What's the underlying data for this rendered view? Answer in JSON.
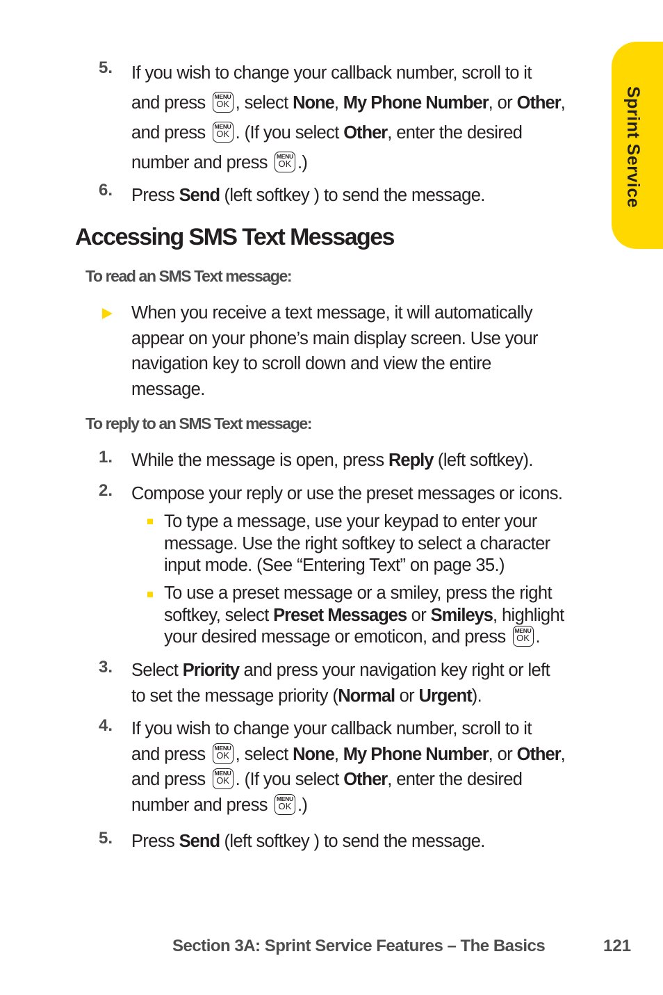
{
  "side_tab": {
    "label": "Sprint Service",
    "color": "#ffd800"
  },
  "key_icon": {
    "top": "MENU",
    "bottom": "OK"
  },
  "top_steps": [
    {
      "number": "5.",
      "lines": [
        [
          "If you wish to change your callback number, scroll to it"
        ],
        [
          "and press",
          "KEY",
          ", select ",
          "b:None",
          ", ",
          "b:My Phone Number",
          ", or ",
          "b:Other",
          ","
        ],
        [
          "and press",
          "KEY",
          ". (If you select ",
          "b:Other",
          ", enter the desired"
        ],
        [
          "number and press",
          "KEY",
          ".)"
        ]
      ]
    },
    {
      "number": "6.",
      "lines": [
        [
          "Press ",
          "b:Send",
          " (left softkey ) to send the message."
        ]
      ]
    }
  ],
  "heading": "Accessing SMS Text Messages",
  "read_section": {
    "title": "To read an SMS Text message:",
    "bullet_lines": [
      "When you receive a text message, it will automatically",
      "appear on your phone’s main display screen. Use your",
      "navigation key to scroll down and view the entire",
      "message."
    ]
  },
  "reply_section": {
    "title": "To reply to an SMS Text message:",
    "steps": [
      {
        "number": "1.",
        "lines": [
          [
            "While the message is open, press ",
            "b:Reply",
            " (left softkey)."
          ]
        ]
      },
      {
        "number": "2.",
        "lines": [
          [
            "Compose your reply or use the preset messages or icons."
          ]
        ]
      },
      {
        "number": "3.",
        "lines": [
          [
            "Select ",
            "b:Priority",
            " and press your navigation key right or left"
          ],
          [
            "to set the message priority (",
            "b:Normal",
            " or ",
            "b:Urgent",
            ")."
          ]
        ]
      },
      {
        "number": "4.",
        "lines": [
          [
            "If you wish to change your callback number, scroll to it"
          ],
          [
            "and press",
            "KEY",
            ", select ",
            "b:None",
            ", ",
            "b:My Phone Number",
            ", or ",
            "b:Other",
            ","
          ],
          [
            "and press",
            "KEY",
            ". (If you select ",
            "b:Other",
            ", enter the desired"
          ],
          [
            "number and press",
            "KEY",
            ".)"
          ]
        ]
      },
      {
        "number": "5.",
        "lines": [
          [
            "Press ",
            "b:Send",
            " (left softkey ) to send the message."
          ]
        ]
      }
    ],
    "sub_bullets": [
      {
        "lines": [
          [
            "To type a message, use your keypad to enter your"
          ],
          [
            "message. Use the right softkey to select a character"
          ],
          [
            "input mode. (See “Entering Text” on page 35.)"
          ]
        ]
      },
      {
        "lines": [
          [
            "To use a preset message or a smiley, press the right"
          ],
          [
            "softkey, select ",
            "b:Preset Messages",
            " or ",
            "b:Smileys",
            ", highlight"
          ],
          [
            "your desired message or emoticon, and press",
            "KEY",
            "."
          ]
        ]
      }
    ]
  },
  "footer": {
    "section": "Section 3A: Sprint Service Features – The Basics",
    "page": "121"
  }
}
